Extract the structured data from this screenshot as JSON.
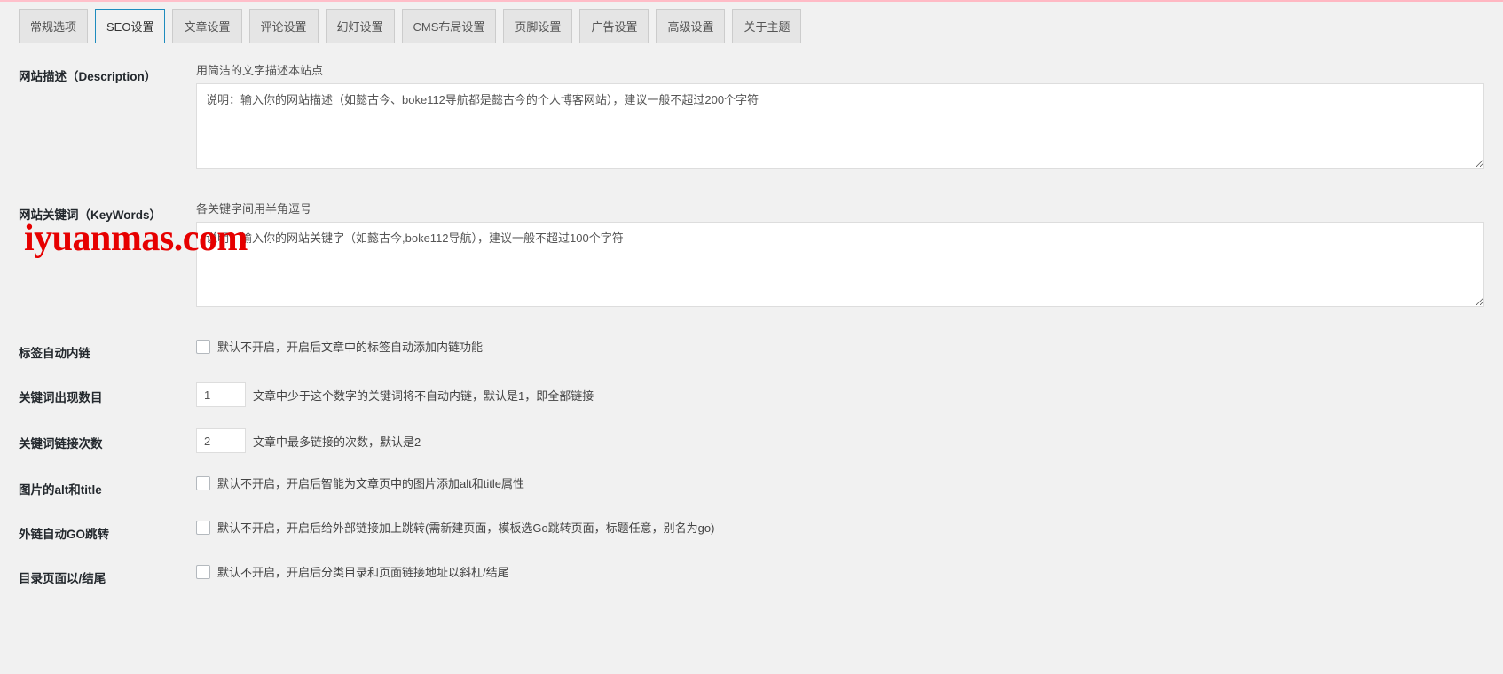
{
  "topbar_color": "#ffc0cb",
  "tabs": [
    {
      "label": "常规选项",
      "active": false
    },
    {
      "label": "SEO设置",
      "active": true
    },
    {
      "label": "文章设置",
      "active": false
    },
    {
      "label": "评论设置",
      "active": false
    },
    {
      "label": "幻灯设置",
      "active": false
    },
    {
      "label": "CMS布局设置",
      "active": false
    },
    {
      "label": "页脚设置",
      "active": false
    },
    {
      "label": "广告设置",
      "active": false
    },
    {
      "label": "高级设置",
      "active": false
    },
    {
      "label": "关于主题",
      "active": false
    }
  ],
  "fields": {
    "description": {
      "label": "网站描述（Description）",
      "hint": "用简洁的文字描述本站点",
      "value": "说明：输入你的网站描述（如懿古今、boke112导航都是懿古今的个人博客网站），建议一般不超过200个字符"
    },
    "keywords": {
      "label": "网站关键词（KeyWords）",
      "hint": "各关键字间用半角逗号",
      "value": "说明：输入你的网站关键字（如懿古今,boke112导航），建议一般不超过100个字符"
    },
    "tag_autolink": {
      "label": "标签自动内链",
      "desc": "默认不开启，开启后文章中的标签自动添加内链功能"
    },
    "keyword_count": {
      "label": "关键词出现数目",
      "value": "1",
      "desc": "文章中少于这个数字的关键词将不自动内链，默认是1，即全部链接"
    },
    "keyword_link_times": {
      "label": "关键词链接次数",
      "value": "2",
      "desc": "文章中最多链接的次数，默认是2"
    },
    "img_alt_title": {
      "label": "图片的alt和title",
      "desc": "默认不开启，开启后智能为文章页中的图片添加alt和title属性"
    },
    "external_go": {
      "label": "外链自动GO跳转",
      "desc": "默认不开启，开启后给外部链接加上跳转(需新建页面，模板选Go跳转页面，标题任意，别名为go)"
    },
    "dir_slash": {
      "label": "目录页面以/结尾",
      "desc": "默认不开启，开启后分类目录和页面链接地址以斜杠/结尾"
    }
  },
  "watermark": "iyuanmas.com"
}
